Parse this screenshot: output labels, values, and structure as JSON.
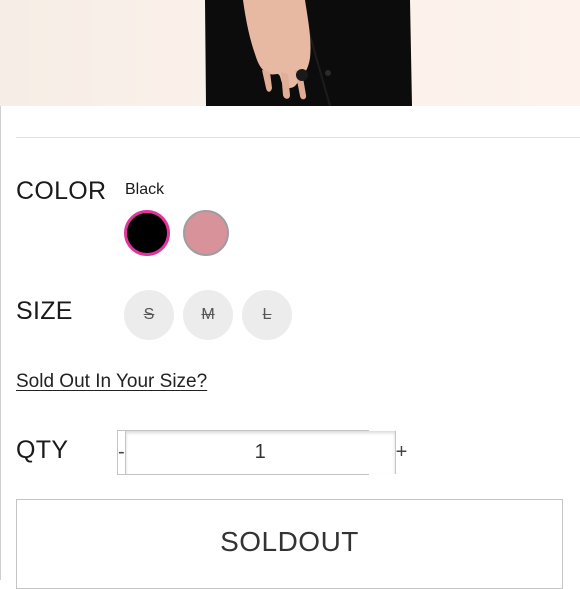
{
  "color_section": {
    "label": "COLOR",
    "selected_name": "Black",
    "swatches": [
      {
        "name": "Black",
        "hex": "#000000",
        "selected": true
      },
      {
        "name": "Pink",
        "hex": "#d8929a",
        "selected": false
      }
    ],
    "selected_ring_color": "#e0359a"
  },
  "size_section": {
    "label": "SIZE",
    "options": [
      {
        "label": "S",
        "available": false
      },
      {
        "label": "M",
        "available": false
      },
      {
        "label": "L",
        "available": false
      }
    ]
  },
  "sold_out_link": "Sold Out In Your Size?",
  "qty_section": {
    "label": "QTY",
    "minus": "-",
    "value": "1",
    "plus": "+"
  },
  "primary_button": "SOLDOUT"
}
